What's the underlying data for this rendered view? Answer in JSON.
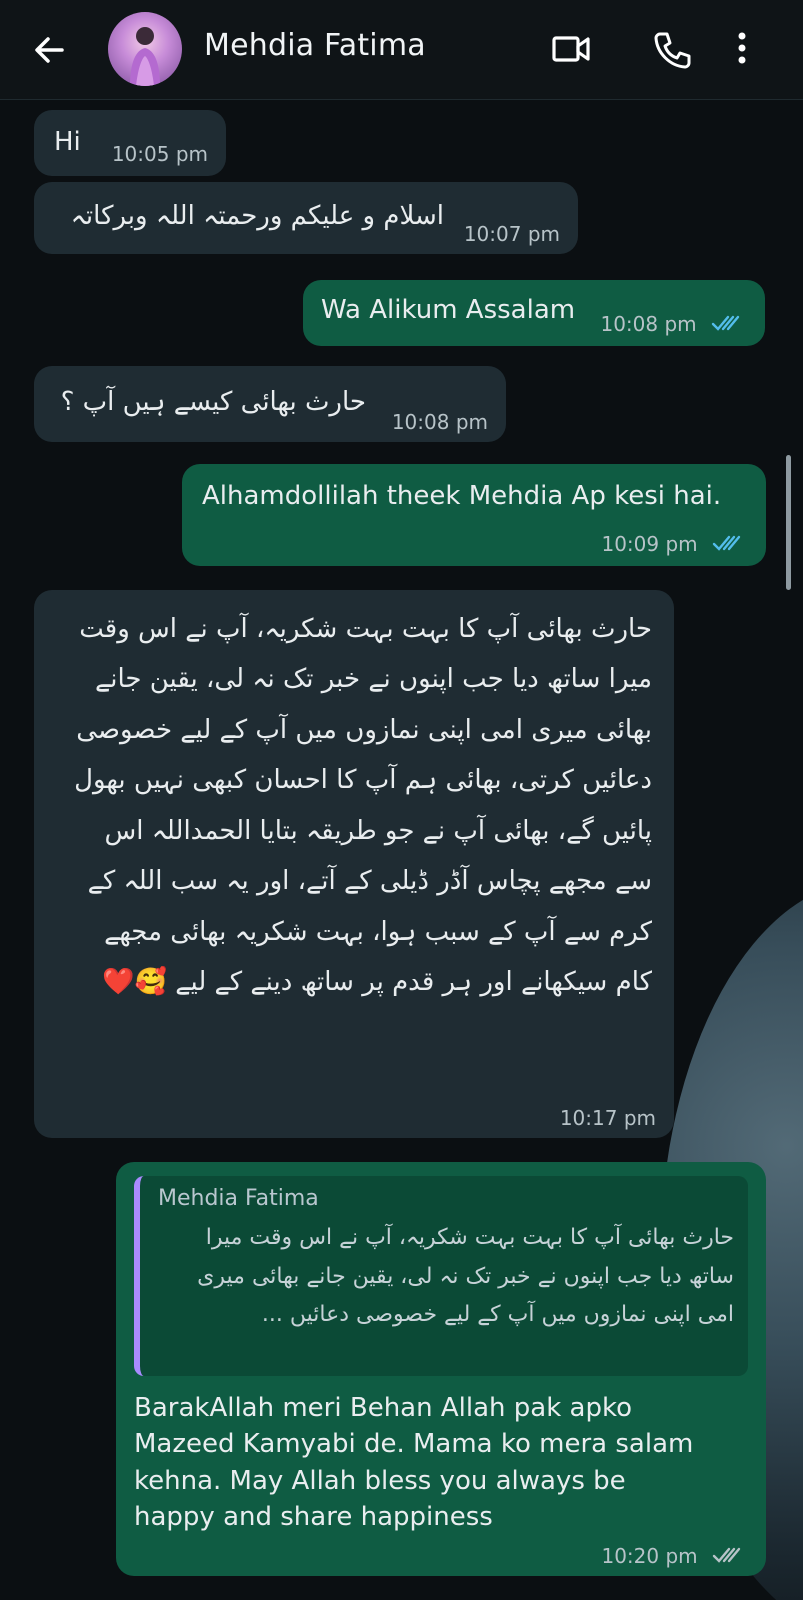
{
  "header": {
    "contact_name": "Mehdia Fatima"
  },
  "messages": {
    "m1": {
      "text": "Hi",
      "time": "10:05 pm"
    },
    "m2": {
      "text": "اسلام و علیکم ورحمتہ اللہ وبرکاتہ",
      "time": "10:07 pm"
    },
    "m3": {
      "text": "Wa Alikum Assalam",
      "time": "10:08 pm"
    },
    "m4": {
      "text": "حارث بھائی کیسے ہیں آپ ؟",
      "time": "10:08 pm"
    },
    "m5": {
      "text": "Alhamdollilah theek Mehdia Ap kesi hai.",
      "time": "10:09 pm"
    },
    "m6": {
      "text": "حارث بھائی آپ کا بہت بہت شکریہ، آپ نے اس وقت میرا ساتھ دیا جب اپنوں نے خبر تک نہ لی، یقین جانے بھائی میری امی اپنی نمازوں میں آپ کے لیے خصوصی دعائیں کرتی، بھائی ہم آپ کا احسان کبھی نہیں بھول پائیں گے، بھائی آپ نے جو طریقہ بتایا الحمداللہ اس سے مجھے پچاس آڈر ڈیلی کے آتے، اور یہ سب اللہ کے کرم سے آپ کے سبب ہوا، بہت شکریہ بھائی مجھے کام سیکھانے اور ہر قدم پر ساتھ دینے کے لیے 🥰❤️",
      "time": "10:17 pm"
    },
    "m7": {
      "quote_name": "Mehdia Fatima",
      "quote_text": "حارث بھائی آپ کا بہت بہت شکریہ، آپ نے اس وقت میرا ساتھ دیا جب اپنوں نے خبر تک نہ لی، یقین جانے بھائی میری امی اپنی نمازوں میں آپ کے لیے خصوصی دعائیں ...",
      "text": "BarakAllah meri Behan Allah pak apko Mazeed Kamyabi de. Mama ko mera salam kehna. May Allah bless you always be happy and share happiness",
      "time": "10:20 pm"
    }
  },
  "colors": {
    "incoming_bubble": "#1f2c33",
    "outgoing_bubble": "#0f5c43",
    "read_ticks": "#53bdeb"
  },
  "icons": [
    "arrow-back-icon",
    "video-camera-icon",
    "phone-icon",
    "more-vert-icon",
    "double-check-icon"
  ]
}
